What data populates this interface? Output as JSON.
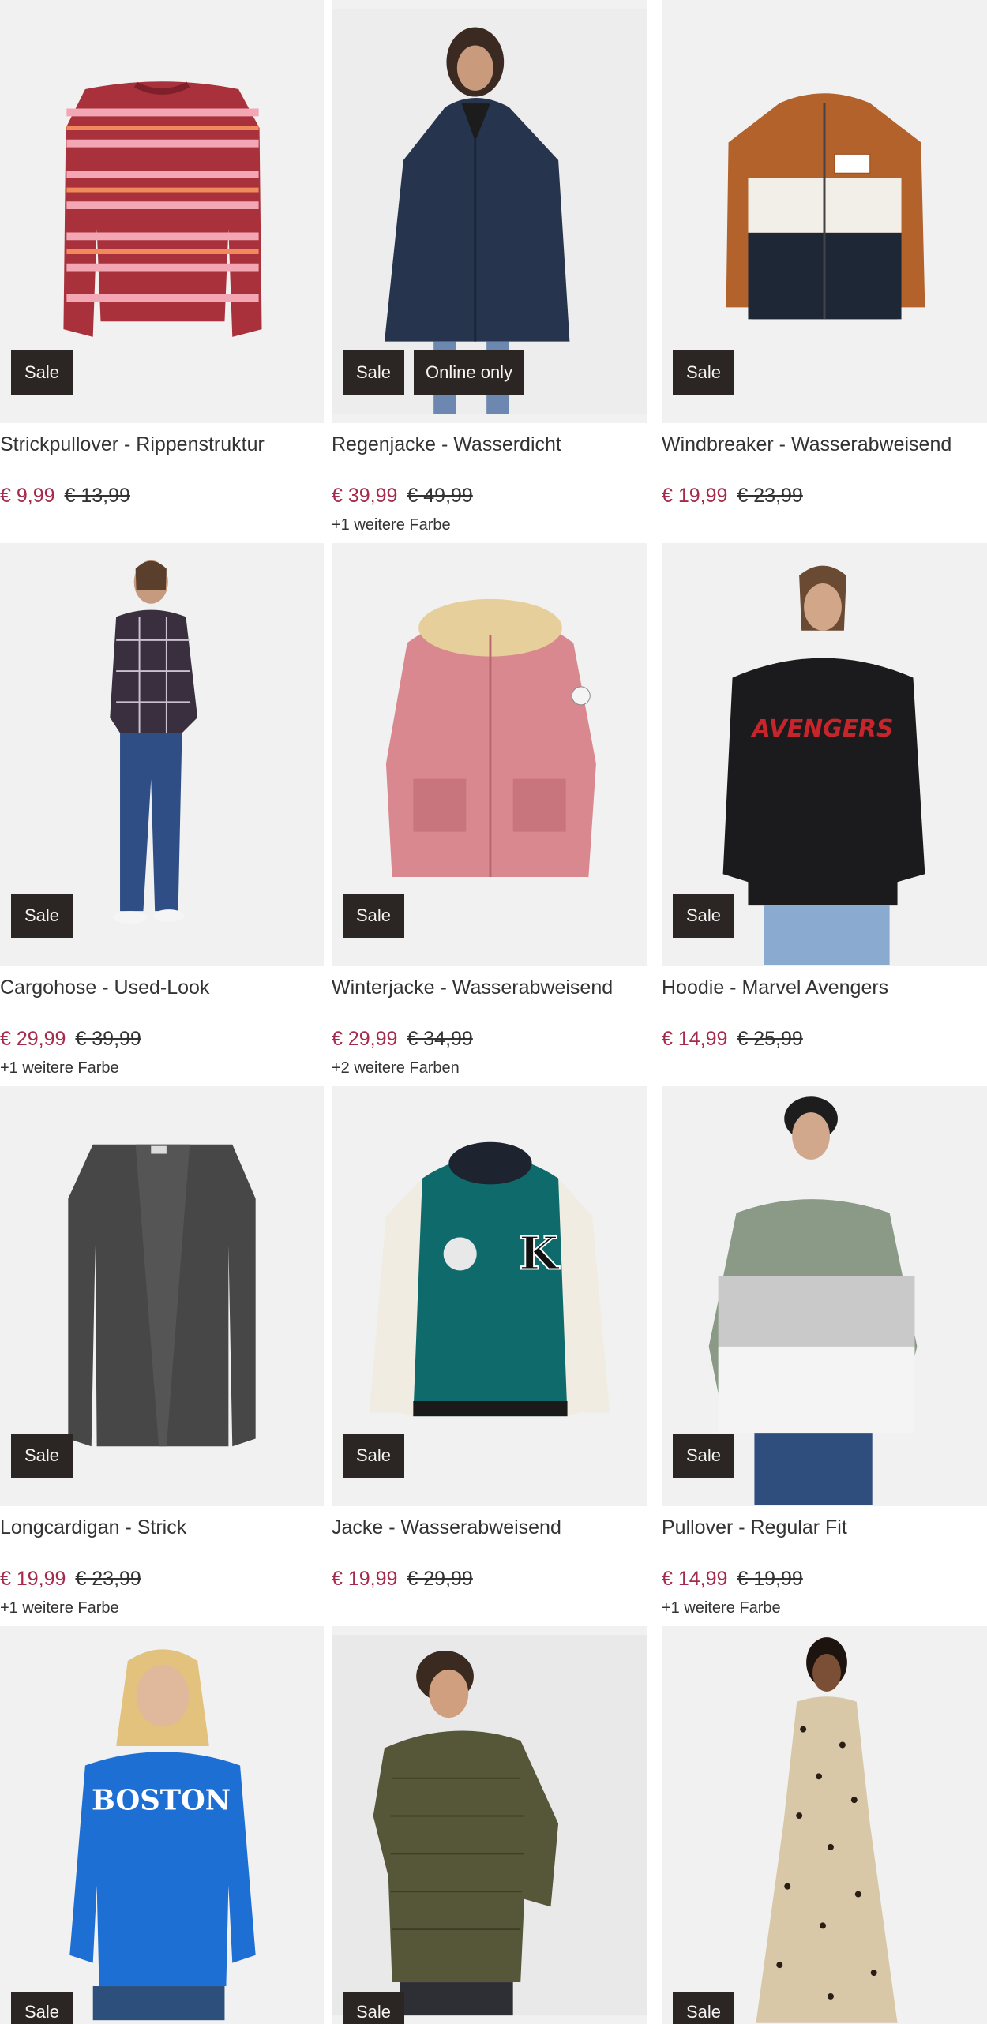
{
  "colors": {
    "image_bg": "#f1f1f1",
    "badge_bg": "#2b2523",
    "sale_price": "#a52a4b"
  },
  "products": [
    {
      "name": "Strickpullover - Rippenstruktur",
      "price": "€ 9,99",
      "old_price": "€ 13,99",
      "badges": [
        "Sale"
      ],
      "more_colors": "",
      "image": "striped-sweater"
    },
    {
      "name": "Regenjacke - Wasserdicht",
      "price": "€ 39,99",
      "old_price": "€ 49,99",
      "badges": [
        "Sale",
        "Online only"
      ],
      "more_colors": "+1 weitere Farbe",
      "image": "navy-rain-jacket"
    },
    {
      "name": "Windbreaker - Wasserabweisend",
      "price": "€ 19,99",
      "old_price": "€ 23,99",
      "badges": [
        "Sale"
      ],
      "more_colors": "",
      "image": "colorblock-windbreaker"
    },
    {
      "name": "Cargohose - Used-Look",
      "price": "€ 29,99",
      "old_price": "€ 39,99",
      "badges": [
        "Sale"
      ],
      "more_colors": "+1 weitere Farbe",
      "image": "man-cargo-jeans"
    },
    {
      "name": "Winterjacke - Wasserabweisend",
      "price": "€ 29,99",
      "old_price": "€ 34,99",
      "badges": [
        "Sale"
      ],
      "more_colors": "+2 weitere Farben",
      "image": "pink-parka"
    },
    {
      "name": "Hoodie - Marvel Avengers",
      "price": "€ 14,99",
      "old_price": "€ 25,99",
      "badges": [
        "Sale"
      ],
      "more_colors": "",
      "image": "black-avengers-hoodie"
    },
    {
      "name": "Longcardigan - Strick",
      "price": "€ 19,99",
      "old_price": "€ 23,99",
      "badges": [
        "Sale"
      ],
      "more_colors": "+1 weitere Farbe",
      "image": "grey-long-cardigan"
    },
    {
      "name": "Jacke - Wasserabweisend",
      "price": "€ 19,99",
      "old_price": "€ 29,99",
      "badges": [
        "Sale"
      ],
      "more_colors": "",
      "image": "teal-college-jacket"
    },
    {
      "name": "Pullover - Regular Fit",
      "price": "€ 14,99",
      "old_price": "€ 19,99",
      "badges": [
        "Sale"
      ],
      "more_colors": "+1 weitere Farbe",
      "image": "colorblock-pullover"
    },
    {
      "name": "",
      "price": "",
      "old_price": "",
      "badges": [
        "Sale"
      ],
      "more_colors": "",
      "image": "blue-boston-sweatshirt",
      "print_text": "BOSTON"
    },
    {
      "name": "",
      "price": "",
      "old_price": "",
      "badges": [
        "Sale"
      ],
      "more_colors": "",
      "image": "olive-knit-sweater"
    },
    {
      "name": "",
      "price": "",
      "old_price": "",
      "badges": [
        "Sale"
      ],
      "more_colors": "",
      "image": "leopard-dress"
    }
  ]
}
